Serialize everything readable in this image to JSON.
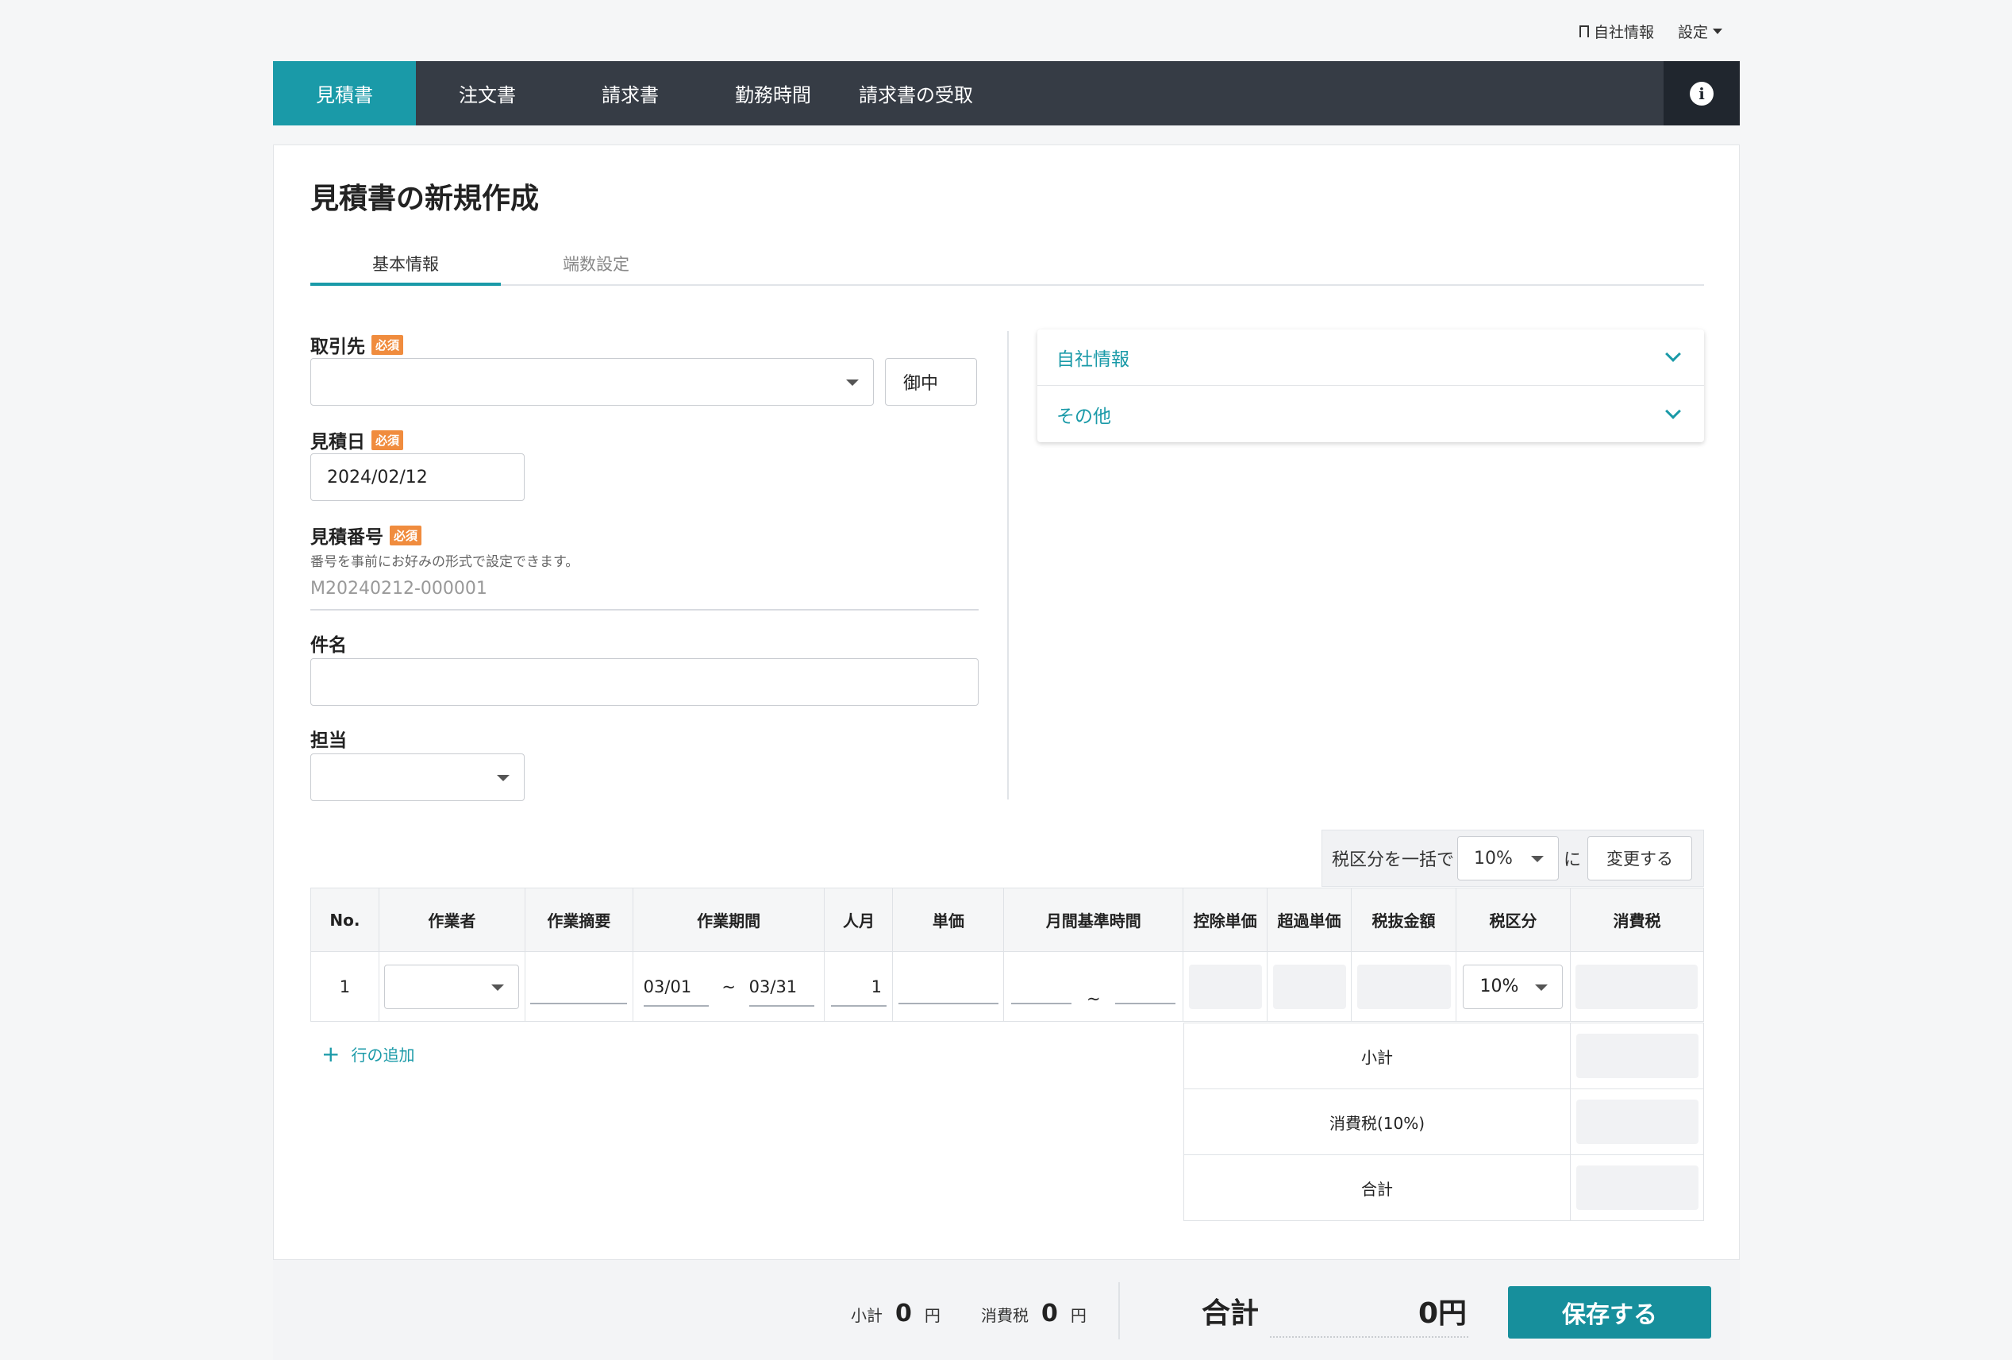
{
  "top_links": {
    "company_info": "自社情報",
    "settings": "設定"
  },
  "nav": {
    "tabs": [
      {
        "label": "見積書"
      },
      {
        "label": "注文書"
      },
      {
        "label": "請求書"
      },
      {
        "label": "勤務時間"
      },
      {
        "label": "請求書の受取"
      }
    ],
    "info_glyph": "i"
  },
  "page": {
    "title": "見積書の新規作成",
    "subtabs": [
      "基本情報",
      "端数設定"
    ]
  },
  "form": {
    "client_label": "取引先",
    "required_badge": "必須",
    "honorific_button": "御中",
    "estimate_date_label": "見積日",
    "estimate_date_value": "2024/02/12",
    "estimate_number_label": "見積番号",
    "estimate_number_hint": "番号を事前にお好みの形式で設定できます。",
    "estimate_number_value": "M20240212-000001",
    "subject_label": "件名",
    "assignee_label": "担当"
  },
  "accordion": [
    "自社情報",
    "その他"
  ],
  "bulk_tax": {
    "prefix": "税区分を一括で",
    "value": "10%",
    "suffix": "に",
    "button": "変更する"
  },
  "table": {
    "headers": [
      "No.",
      "作業者",
      "作業摘要",
      "作業期間",
      "人月",
      "単価",
      "月間基準時間",
      "控除単価",
      "超過単価",
      "税抜金額",
      "税区分",
      "消費税"
    ],
    "rows": [
      {
        "no": "1",
        "period_start": "03/01",
        "period_sep": "~",
        "period_end": "03/31",
        "man_month": "1",
        "hours_sep": "~",
        "tax": "10%"
      }
    ],
    "add_row": "行の追加",
    "add_icon": "+"
  },
  "summary": [
    {
      "label": "小計"
    },
    {
      "label": "消費税(10%)"
    },
    {
      "label": "合計"
    }
  ],
  "footer": {
    "subtotal_label": "小計",
    "subtotal_value": "0",
    "yen": "円",
    "tax_label": "消費税",
    "tax_value": "0",
    "total_label": "合計",
    "total_value": "0円",
    "save_button": "保存する"
  },
  "colors": {
    "accent": "#1a9aa8",
    "nav_bg": "#363c45",
    "required": "#f08c3e"
  }
}
